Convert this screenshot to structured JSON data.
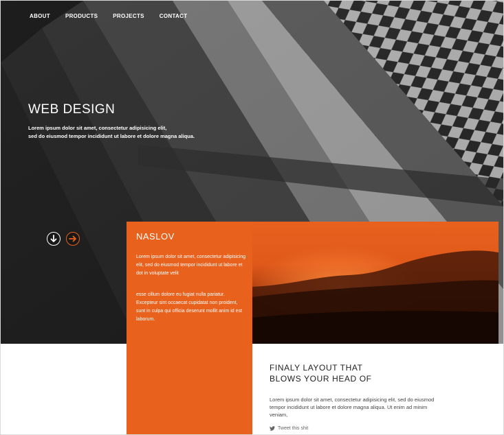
{
  "nav": {
    "items": [
      {
        "label": "ABOUT"
      },
      {
        "label": "PRODUCTS"
      },
      {
        "label": "PROJECTS"
      },
      {
        "label": "CONTACT"
      }
    ]
  },
  "hero": {
    "title": "WEB DESIGN",
    "text_line1": "Lorem ipsum dolor sit amet, consectetur adipisicing elit,",
    "text_line2": "sed do eiusmod tempor incididunt ut labore et dolore magna aliqua.",
    "down_icon": "arrow-down-icon",
    "next_icon": "arrow-right-icon"
  },
  "card": {
    "title": "NASLOV",
    "paragraph1": "Lorem ipsum dolor sit amet, consectetur adipisicing elit, sed do eiusmod tempor incididunt ut labore et dot in voluptate velit",
    "paragraph2": "esse cillum dolore eu fugiat nulla pariatur. Excepteur sint occaecat cupidatat non proident, sunt in culpa qui officia deserunt mollit anim id est laborum."
  },
  "article": {
    "title_line1": "FINALY LAYOUT THAT",
    "title_line2": "BLOWS YOUR HEAD OF",
    "text": "Lorem ipsum dolor sit amet, consectetur adipisicing elit, sed do eiusmod tempor incididunt ut labore et dolore magna aliqua. Ut enim ad minim veniam,",
    "tweet_label": "Tweet this shit",
    "tweet_icon": "twitter-icon"
  },
  "colors": {
    "accent": "#e8611d",
    "hero_dark": "#1e1e1e"
  }
}
